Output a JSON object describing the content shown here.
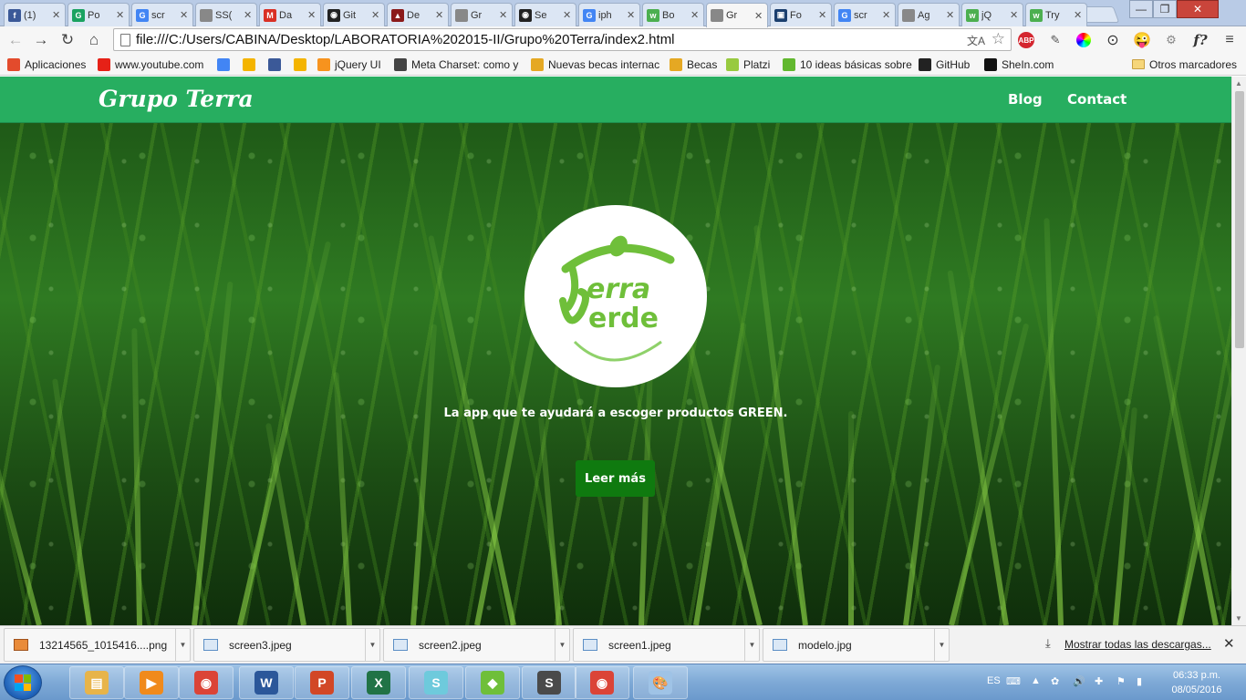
{
  "browser": {
    "tabs": [
      {
        "label": "(1)",
        "favicon": "facebook-icon",
        "color": "#3b5998",
        "glyph": "f"
      },
      {
        "label": "Po",
        "favicon": "google-docs-icon",
        "color": "#1aa260",
        "glyph": "G"
      },
      {
        "label": "scr",
        "favicon": "google-icon",
        "color": "#4285f4",
        "glyph": "G"
      },
      {
        "label": "SS(",
        "favicon": "page-icon",
        "color": "#888888",
        "glyph": ""
      },
      {
        "label": "Da",
        "favicon": "gmail-icon",
        "color": "#d93025",
        "glyph": "M"
      },
      {
        "label": "Git",
        "favicon": "github-icon",
        "color": "#222222",
        "glyph": "◉"
      },
      {
        "label": "De",
        "favicon": "design-icon",
        "color": "#8b1a1a",
        "glyph": "▲"
      },
      {
        "label": "Gr",
        "favicon": "page-icon",
        "color": "#888888",
        "glyph": ""
      },
      {
        "label": "Se",
        "favicon": "github-icon",
        "color": "#222222",
        "glyph": "◉"
      },
      {
        "label": "iph",
        "favicon": "google-icon",
        "color": "#4285f4",
        "glyph": "G"
      },
      {
        "label": "Bo",
        "favicon": "w3-icon",
        "color": "#4caf50",
        "glyph": "w"
      },
      {
        "label": "Gr",
        "favicon": "page-icon",
        "color": "#888888",
        "glyph": "",
        "active": true
      },
      {
        "label": "Fo",
        "favicon": "image-icon",
        "color": "#1b3f6e",
        "glyph": "▣"
      },
      {
        "label": "scr",
        "favicon": "google-icon",
        "color": "#4285f4",
        "glyph": "G"
      },
      {
        "label": "Ag",
        "favicon": "page-icon",
        "color": "#888888",
        "glyph": ""
      },
      {
        "label": "jQ",
        "favicon": "w3-icon",
        "color": "#4caf50",
        "glyph": "w"
      },
      {
        "label": "Try",
        "favicon": "w3-icon",
        "color": "#4caf50",
        "glyph": "w"
      }
    ],
    "address": "file:///C:/Users/CABINA/Desktop/LABORATORIA%202015-II/Grupo%20Terra/index2.html",
    "bookmarks": [
      {
        "label": "Aplicaciones",
        "icon": "apps-icon",
        "color": "#e34b2c"
      },
      {
        "label": "www.youtube.com",
        "icon": "youtube-icon",
        "color": "#e62117"
      },
      {
        "label": "",
        "icon": "chrome-icon",
        "color": "#4285f4"
      },
      {
        "label": "",
        "icon": "drive-icon",
        "color": "#f4b400"
      },
      {
        "label": "",
        "icon": "facebook-icon",
        "color": "#3b5998"
      },
      {
        "label": "",
        "icon": "drive-icon",
        "color": "#f4b400"
      },
      {
        "label": "jQuery UI",
        "icon": "jquery-icon",
        "color": "#f7931e"
      },
      {
        "label": "Meta Charset: como y",
        "icon": "cyb-icon",
        "color": "#444444"
      },
      {
        "label": "Nuevas becas internac",
        "icon": "becas-icon",
        "color": "#e5a823"
      },
      {
        "label": "Becas",
        "icon": "becas-icon",
        "color": "#e5a823"
      },
      {
        "label": "Platzi",
        "icon": "platzi-icon",
        "color": "#98ca3f"
      },
      {
        "label": "10 ideas básicas sobre",
        "icon": "ideas-icon",
        "color": "#62b82f"
      },
      {
        "label": "GitHub",
        "icon": "github-icon",
        "color": "#222222"
      },
      {
        "label": "SheIn.com",
        "icon": "shein-icon",
        "color": "#111111"
      }
    ],
    "other_bookmarks": "Otros marcadores"
  },
  "page": {
    "brand": "Grupo Terra",
    "nav": {
      "blog": "Blog",
      "contact": "Contact"
    },
    "logo": {
      "line1": "erra",
      "line2": "erde",
      "alt": "Terra Verde"
    },
    "tagline_prefix": "La app que te ayudará a escoger productos ",
    "tagline_strong": "GREEN",
    "tagline_suffix": ".",
    "cta": "Leer más",
    "colors": {
      "navbar": "#27ae60",
      "cta": "#0f7a0f",
      "logo_green": "#6fbf3a"
    }
  },
  "downloads": {
    "items": [
      {
        "name": "13214565_1015416....png",
        "icon": "png-file-icon"
      },
      {
        "name": "screen3.jpeg",
        "icon": "image-file-icon"
      },
      {
        "name": "screen2.jpeg",
        "icon": "image-file-icon"
      },
      {
        "name": "screen1.jpeg",
        "icon": "image-file-icon"
      },
      {
        "name": "modelo.jpg",
        "icon": "image-file-icon"
      }
    ],
    "show_all": "Mostrar todas las descargas..."
  },
  "taskbar": {
    "apps": [
      {
        "name": "file-explorer-icon",
        "color": "#e7b44a",
        "glyph": "▤"
      },
      {
        "name": "media-player-icon",
        "color": "#f08a1c",
        "glyph": "▶"
      },
      {
        "name": "chrome-icon",
        "color": "#db4437",
        "glyph": "◉"
      },
      {
        "name": "word-icon",
        "color": "#2b579a",
        "glyph": "W"
      },
      {
        "name": "powerpoint-icon",
        "color": "#d24726",
        "glyph": "P"
      },
      {
        "name": "excel-icon",
        "color": "#217346",
        "glyph": "X"
      },
      {
        "name": "slack-icon",
        "color": "#6ecadc",
        "glyph": "S"
      },
      {
        "name": "sourcetree-icon",
        "color": "#6fbf3a",
        "glyph": "◆"
      },
      {
        "name": "sublime-icon",
        "color": "#4a4a4a",
        "glyph": "S"
      },
      {
        "name": "chrome-icon",
        "color": "#db4437",
        "glyph": "◉"
      },
      {
        "name": "paint-icon",
        "color": "#9fc3e6",
        "glyph": "🎨"
      }
    ],
    "lang": "ES",
    "time": "06:33 p.m.",
    "date": "08/05/2016"
  }
}
